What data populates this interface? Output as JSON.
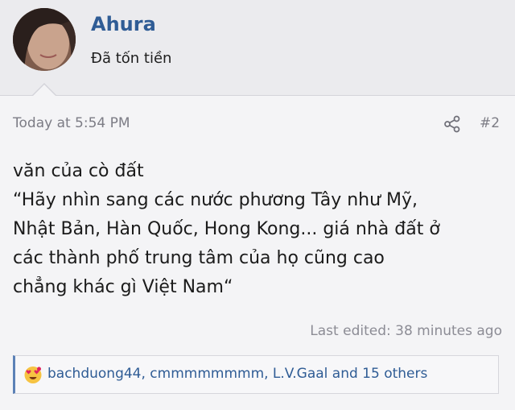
{
  "user": {
    "name": "Ahura",
    "title": "Đã tốn tiền"
  },
  "post": {
    "timestamp": "Today at 5:54 PM",
    "number": "#2",
    "lines": [
      "văn của cò đất",
      "“Hãy nhìn sang các nước phương Tây như Mỹ,",
      "Nhật Bản, Hàn Quốc, Hong Kong... giá nhà đất ở",
      "các thành phố trung tâm của họ cũng cao",
      "chẳng khác gì Việt Nam“"
    ],
    "last_edited": "Last edited: 38 minutes ago"
  },
  "reactions": {
    "text": "bachduong44, cmmmmmmmm, L.V.Gaal and 15 others",
    "emoji_icon": "love-face-icon"
  },
  "colors": {
    "link": "#2f5c95",
    "reaction_bar": "#5c81b6"
  }
}
